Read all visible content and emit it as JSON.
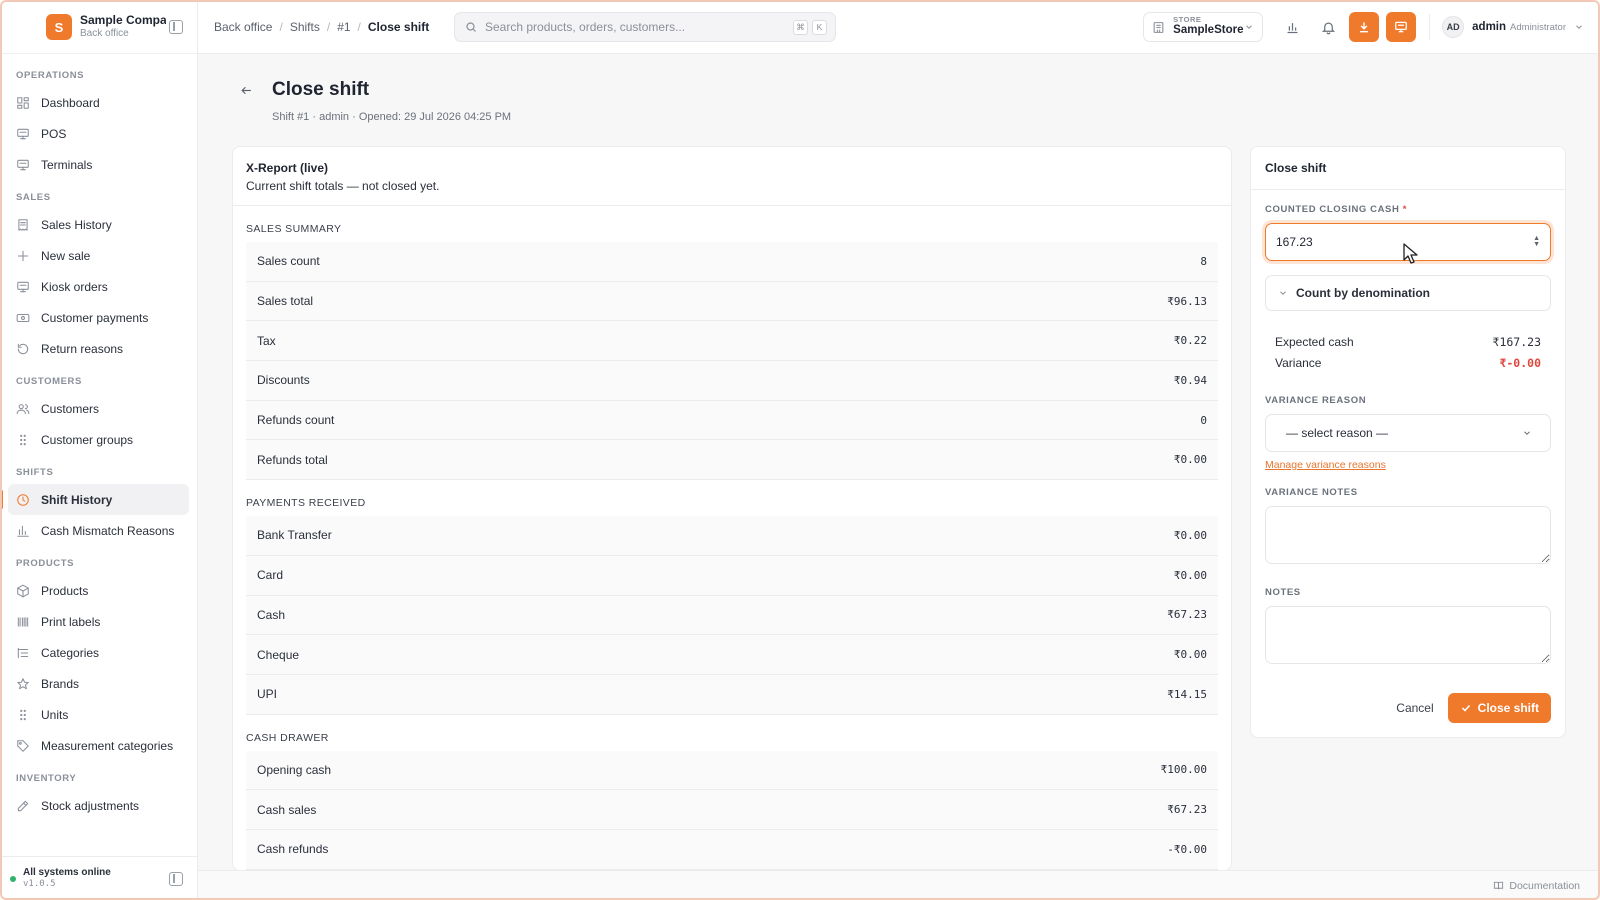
{
  "brand": {
    "initial": "S",
    "name": "Sample Compa",
    "sub": "Back office"
  },
  "sidebar": {
    "sections": [
      {
        "title": "OPERATIONS",
        "items": [
          {
            "label": "Dashboard",
            "icon": "dashboard-icon"
          },
          {
            "label": "POS",
            "icon": "monitor-icon"
          },
          {
            "label": "Terminals",
            "icon": "monitor-icon"
          }
        ]
      },
      {
        "title": "SALES",
        "items": [
          {
            "label": "Sales History",
            "icon": "receipt-icon"
          },
          {
            "label": "New sale",
            "icon": "plus-icon"
          },
          {
            "label": "Kiosk orders",
            "icon": "monitor-icon"
          },
          {
            "label": "Customer payments",
            "icon": "banknote-icon"
          },
          {
            "label": "Return reasons",
            "icon": "undo-icon"
          }
        ]
      },
      {
        "title": "CUSTOMERS",
        "items": [
          {
            "label": "Customers",
            "icon": "users-icon"
          },
          {
            "label": "Customer groups",
            "icon": "grip-icon"
          }
        ]
      },
      {
        "title": "SHIFTS",
        "items": [
          {
            "label": "Shift History",
            "icon": "clock-icon",
            "active": true
          },
          {
            "label": "Cash Mismatch Reasons",
            "icon": "bar-chart-icon"
          }
        ]
      },
      {
        "title": "PRODUCTS",
        "items": [
          {
            "label": "Products",
            "icon": "box-icon"
          },
          {
            "label": "Print labels",
            "icon": "barcode-icon"
          },
          {
            "label": "Categories",
            "icon": "tree-icon"
          },
          {
            "label": "Brands",
            "icon": "star-icon"
          },
          {
            "label": "Units",
            "icon": "grip-icon"
          },
          {
            "label": "Measurement categories",
            "icon": "tag-icon"
          }
        ]
      },
      {
        "title": "INVENTORY",
        "items": [
          {
            "label": "Stock adjustments",
            "icon": "edit-icon"
          }
        ]
      }
    ],
    "status": {
      "text": "All systems online",
      "version": "v1.0.5"
    }
  },
  "topbar": {
    "breadcrumb": [
      "Back office",
      "Shifts",
      "#1",
      "Close shift"
    ],
    "search_placeholder": "Search products, orders, customers...",
    "kbd": [
      "⌘",
      "K"
    ],
    "store_label": "STORE",
    "store_value": "SampleStore",
    "user_initials": "AD",
    "user_name": "admin",
    "user_role": "Administrator"
  },
  "page": {
    "title": "Close shift",
    "subtitle": "Shift #1 · admin · Opened: 29 Jul 2026 04:25 PM"
  },
  "report": {
    "title": "X-Report (live)",
    "desc": "Current shift totals — not closed yet.",
    "sections": [
      {
        "title": "SALES SUMMARY",
        "rows": [
          {
            "label": "Sales count",
            "value": "8"
          },
          {
            "label": "Sales total",
            "value": "₹96.13"
          },
          {
            "label": "Tax",
            "value": "₹0.22"
          },
          {
            "label": "Discounts",
            "value": "₹0.94"
          },
          {
            "label": "Refunds count",
            "value": "0"
          },
          {
            "label": "Refunds total",
            "value": "₹0.00"
          }
        ]
      },
      {
        "title": "PAYMENTS RECEIVED",
        "rows": [
          {
            "label": "Bank Transfer",
            "value": "₹0.00"
          },
          {
            "label": "Card",
            "value": "₹0.00"
          },
          {
            "label": "Cash",
            "value": "₹67.23"
          },
          {
            "label": "Cheque",
            "value": "₹0.00"
          },
          {
            "label": "UPI",
            "value": "₹14.15"
          }
        ]
      },
      {
        "title": "CASH DRAWER",
        "rows": [
          {
            "label": "Opening cash",
            "value": "₹100.00"
          },
          {
            "label": "Cash sales",
            "value": "₹67.23"
          },
          {
            "label": "Cash refunds",
            "value": "-₹0.00"
          }
        ]
      }
    ]
  },
  "close_form": {
    "title": "Close shift",
    "counted_label": "COUNTED CLOSING CASH",
    "required_mark": "*",
    "counted_value": "167.23",
    "denomination_label": "Count by denomination",
    "expected_label": "Expected cash",
    "expected_value": "₹167.23",
    "variance_label": "Variance",
    "variance_value": "₹-0.00",
    "variance_reason_label": "VARIANCE REASON",
    "variance_reason_value": "— select reason —",
    "manage_link": "Manage variance reasons",
    "variance_notes_label": "VARIANCE NOTES",
    "notes_label": "NOTES",
    "cancel_label": "Cancel",
    "submit_label": "Close shift"
  },
  "footer": {
    "doc_label": "Documentation"
  },
  "colors": {
    "accent": "#f07a2c",
    "danger": "#e0483e",
    "success": "#2fb36b"
  }
}
